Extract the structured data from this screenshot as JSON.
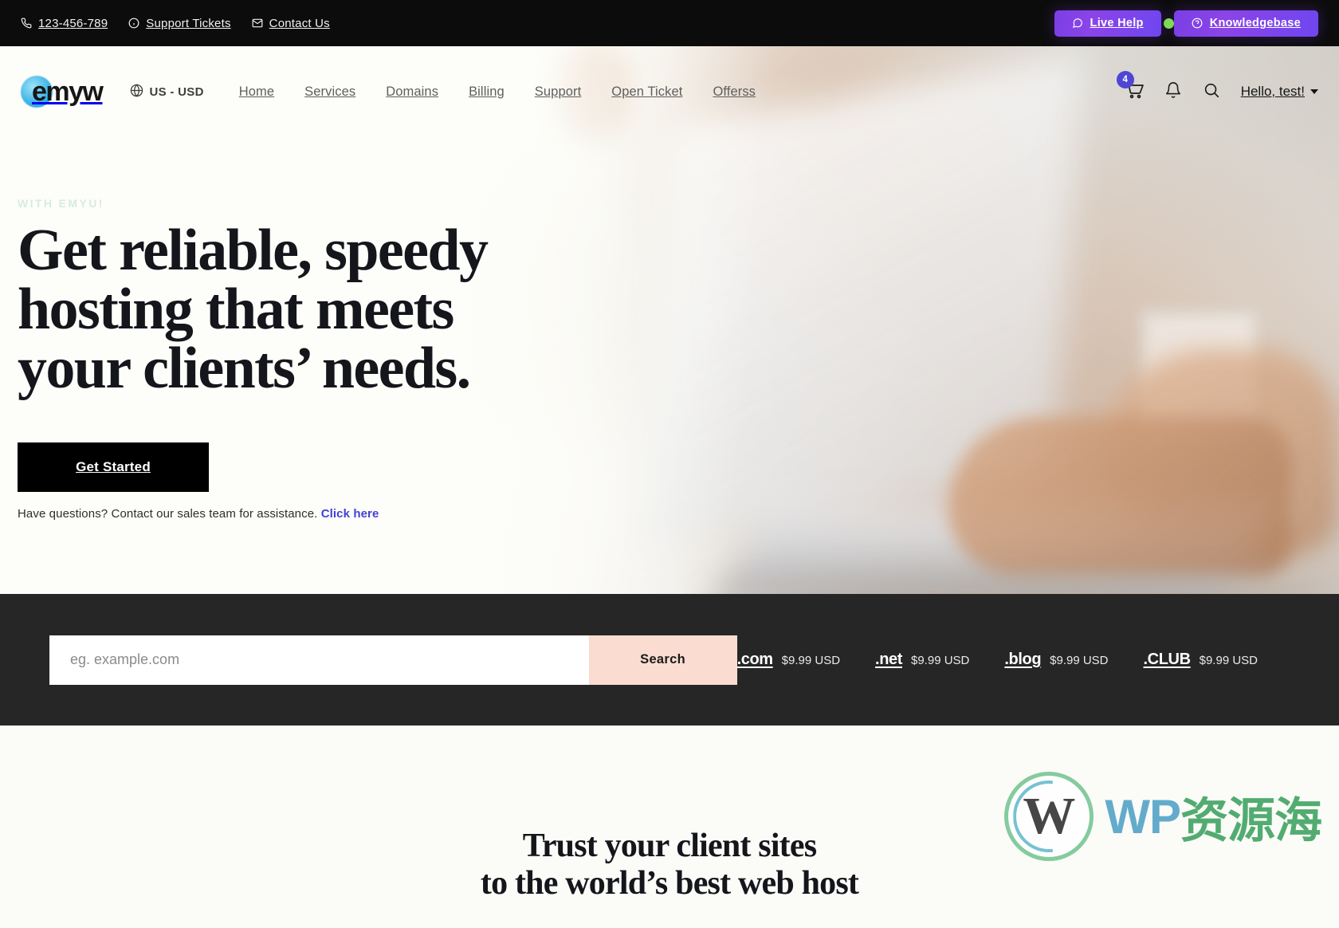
{
  "topbar": {
    "phone": "123-456-789",
    "support_tickets": "Support Tickets",
    "contact_us": "Contact Us",
    "live_help": "Live Help",
    "knowledgebase": "Knowledgebase",
    "accent_color": "#7b3fe4",
    "status_dot_color": "#7ed957",
    "background": "#0c0c0c",
    "icons": {
      "phone": "phone-icon",
      "info": "info-circle-icon",
      "mail": "envelope-icon",
      "chat": "chat-bubble-icon",
      "help": "question-circle-icon"
    }
  },
  "nav": {
    "logo_text": "emyw",
    "currency": "US - USD",
    "links": [
      {
        "label": "Home"
      },
      {
        "label": "Services"
      },
      {
        "label": "Domains"
      },
      {
        "label": "Billing"
      },
      {
        "label": "Support"
      },
      {
        "label": "Open Ticket"
      },
      {
        "label": "Offerss"
      }
    ],
    "cart_count": "4",
    "cart_badge_color": "#4f46d6",
    "account_label": "Hello, test!",
    "icons": {
      "globe": "globe-icon",
      "cart": "shopping-cart-icon",
      "bell": "bell-icon",
      "search": "search-icon",
      "caret": "chevron-down-icon"
    }
  },
  "hero": {
    "eyebrow": "WITH EMYU!",
    "title_line1": "Get reliable, speedy",
    "title_line2": "hosting that meets",
    "title_line3": "your clients’ needs.",
    "cta_label": "Get Started",
    "sub_text": "Have questions? Contact our sales team for assistance.",
    "sub_link": "Click here",
    "link_color": "#4340d8",
    "background": "#fbfaf6"
  },
  "domain_search": {
    "placeholder": "eg. example.com",
    "value": "",
    "button_label": "Search",
    "button_color": "#fadcd1",
    "background": "#262626",
    "tlds": [
      {
        "name": ".com",
        "price": "$9.99 USD"
      },
      {
        "name": ".net",
        "price": "$9.99 USD"
      },
      {
        "name": ".blog",
        "price": "$9.99 USD"
      },
      {
        "name": ".CLUB",
        "price": "$9.99 USD"
      }
    ]
  },
  "bottom": {
    "title_line1": "Trust your client sites",
    "title_line2": "to the world’s best web host",
    "watermark_w": "W",
    "watermark_wp": "WP",
    "watermark_cn": "资源海"
  }
}
